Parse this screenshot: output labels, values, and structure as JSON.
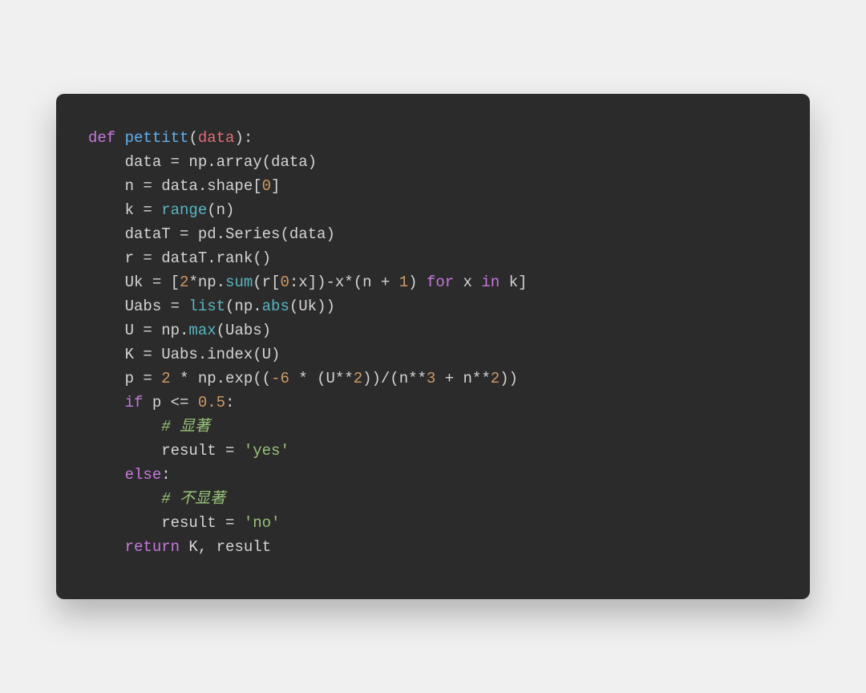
{
  "code": {
    "language": "python",
    "tokens": [
      [
        [
          "def ",
          "kw"
        ],
        [
          "pettitt",
          "fn"
        ],
        [
          "(",
          "punc"
        ],
        [
          "data",
          "id"
        ],
        [
          "):",
          "punc"
        ]
      ],
      [
        [
          "    data = np.array(data)",
          "attr"
        ]
      ],
      [
        [
          "    n = data.shape[",
          "attr"
        ],
        [
          "0",
          "num"
        ],
        [
          "]",
          "attr"
        ]
      ],
      [
        [
          "    k = ",
          "attr"
        ],
        [
          "range",
          "bi"
        ],
        [
          "(n)",
          "attr"
        ]
      ],
      [
        [
          "    dataT = pd.Series(data)",
          "attr"
        ]
      ],
      [
        [
          "    r = dataT.rank()",
          "attr"
        ]
      ],
      [
        [
          "    Uk = [",
          "attr"
        ],
        [
          "2",
          "num"
        ],
        [
          "*np.",
          "attr"
        ],
        [
          "sum",
          "bi"
        ],
        [
          "(r[",
          "attr"
        ],
        [
          "0",
          "num"
        ],
        [
          ":x])-x*(n + ",
          "attr"
        ],
        [
          "1",
          "num"
        ],
        [
          ") ",
          "attr"
        ],
        [
          "for",
          "kw"
        ],
        [
          " x ",
          "attr"
        ],
        [
          "in",
          "kw"
        ],
        [
          " k]",
          "attr"
        ]
      ],
      [
        [
          "    Uabs = ",
          "attr"
        ],
        [
          "list",
          "bi"
        ],
        [
          "(np.",
          "attr"
        ],
        [
          "abs",
          "bi"
        ],
        [
          "(Uk))",
          "attr"
        ]
      ],
      [
        [
          "    U = np.",
          "attr"
        ],
        [
          "max",
          "bi"
        ],
        [
          "(Uabs)",
          "attr"
        ]
      ],
      [
        [
          "    K = Uabs.index(U)",
          "attr"
        ]
      ],
      [
        [
          "    p = ",
          "attr"
        ],
        [
          "2",
          "num"
        ],
        [
          " * np.exp((",
          "attr"
        ],
        [
          "-6",
          "num"
        ],
        [
          " * (U**",
          "attr"
        ],
        [
          "2",
          "num"
        ],
        [
          "))/(n**",
          "attr"
        ],
        [
          "3",
          "num"
        ],
        [
          " + n**",
          "attr"
        ],
        [
          "2",
          "num"
        ],
        [
          "))",
          "attr"
        ]
      ],
      [
        [
          "    ",
          "attr"
        ],
        [
          "if",
          "kw"
        ],
        [
          " p <= ",
          "attr"
        ],
        [
          "0.5",
          "num"
        ],
        [
          ":",
          "attr"
        ]
      ],
      [
        [
          "        ",
          "attr"
        ],
        [
          "# 显著",
          "cmt"
        ]
      ],
      [
        [
          "        result = ",
          "attr"
        ],
        [
          "'yes'",
          "str"
        ]
      ],
      [
        [
          "    ",
          "attr"
        ],
        [
          "else",
          "kw"
        ],
        [
          ":",
          "attr"
        ]
      ],
      [
        [
          "        ",
          "attr"
        ],
        [
          "# 不显著",
          "cmt"
        ]
      ],
      [
        [
          "        result = ",
          "attr"
        ],
        [
          "'no'",
          "str"
        ]
      ],
      [
        [
          "    ",
          "attr"
        ],
        [
          "return",
          "kw"
        ],
        [
          " K, result",
          "attr"
        ]
      ]
    ],
    "plain": "def pettitt(data):\n    data = np.array(data)\n    n = data.shape[0]\n    k = range(n)\n    dataT = pd.Series(data)\n    r = dataT.rank()\n    Uk = [2*np.sum(r[0:x])-x*(n + 1) for x in k]\n    Uabs = list(np.abs(Uk))\n    U = np.max(Uabs)\n    K = Uabs.index(U)\n    p = 2 * np.exp((-6 * (U**2))/(n**3 + n**2))\n    if p <= 0.5:\n        # 显著\n        result = 'yes'\n    else:\n        # 不显著\n        result = 'no'\n    return K, result"
  }
}
